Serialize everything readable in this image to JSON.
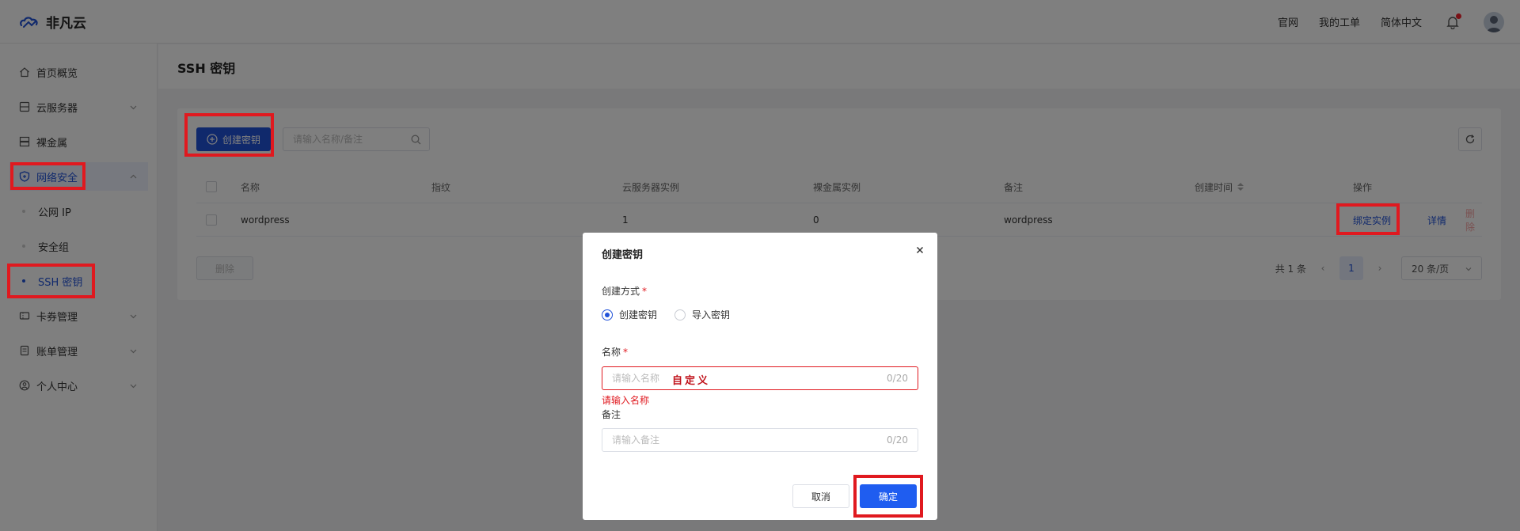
{
  "header": {
    "brand": "非凡云",
    "links": [
      "官网",
      "我的工单",
      "简体中文"
    ],
    "has_notification": true
  },
  "sidebar": {
    "items": [
      {
        "label": "首页概览",
        "icon": "home-icon"
      },
      {
        "label": "云服务器",
        "icon": "server-icon",
        "expandable": true
      },
      {
        "label": "裸金属",
        "icon": "baremetal-icon"
      },
      {
        "label": "网络安全",
        "icon": "shield-icon",
        "expandable": true,
        "expanded": true,
        "active": true
      },
      {
        "label": "卡券管理",
        "icon": "ticket-icon",
        "expandable": true
      },
      {
        "label": "账单管理",
        "icon": "bill-icon",
        "expandable": true
      },
      {
        "label": "个人中心",
        "icon": "user-circle-icon",
        "expandable": true
      }
    ],
    "sub_items": [
      {
        "label": "公网 IP"
      },
      {
        "label": "安全组"
      },
      {
        "label": "SSH 密钥",
        "active": true
      }
    ]
  },
  "page": {
    "title": "SSH 密钥",
    "create_button": "创建密钥",
    "search_placeholder": "请输入名称/备注",
    "delete_button": "删除"
  },
  "table": {
    "columns": [
      "名称",
      "指纹",
      "云服务器实例",
      "裸金属实例",
      "备注",
      "创建时间",
      "操作"
    ],
    "rows": [
      {
        "name": "wordpress",
        "fingerprint": "",
        "cloud_instances": "1",
        "baremetal_instances": "0",
        "note": "wordpress",
        "created": "",
        "actions": [
          "绑定实例",
          "详情",
          "删除"
        ]
      }
    ]
  },
  "pagination": {
    "total": "共 1 条",
    "current": "1",
    "page_size": "20 条/页"
  },
  "modal": {
    "title": "创建密钥",
    "method_label": "创建方式",
    "methods": [
      "创建密钥",
      "导入密钥"
    ],
    "selected_method": "创建密钥",
    "name_label": "名称",
    "name_placeholder": "请输入名称",
    "name_value": "",
    "name_count": "0/20",
    "name_annotation": "自定义",
    "name_error": "请输入名称",
    "note_label": "备注",
    "note_placeholder": "请输入备注",
    "note_count": "0/20",
    "cancel": "取消",
    "confirm": "确定"
  },
  "colors": {
    "primary": "#2152d9",
    "confirm": "#1f5df0",
    "error": "#e0191f",
    "highlight_frame": "#e0191f"
  }
}
